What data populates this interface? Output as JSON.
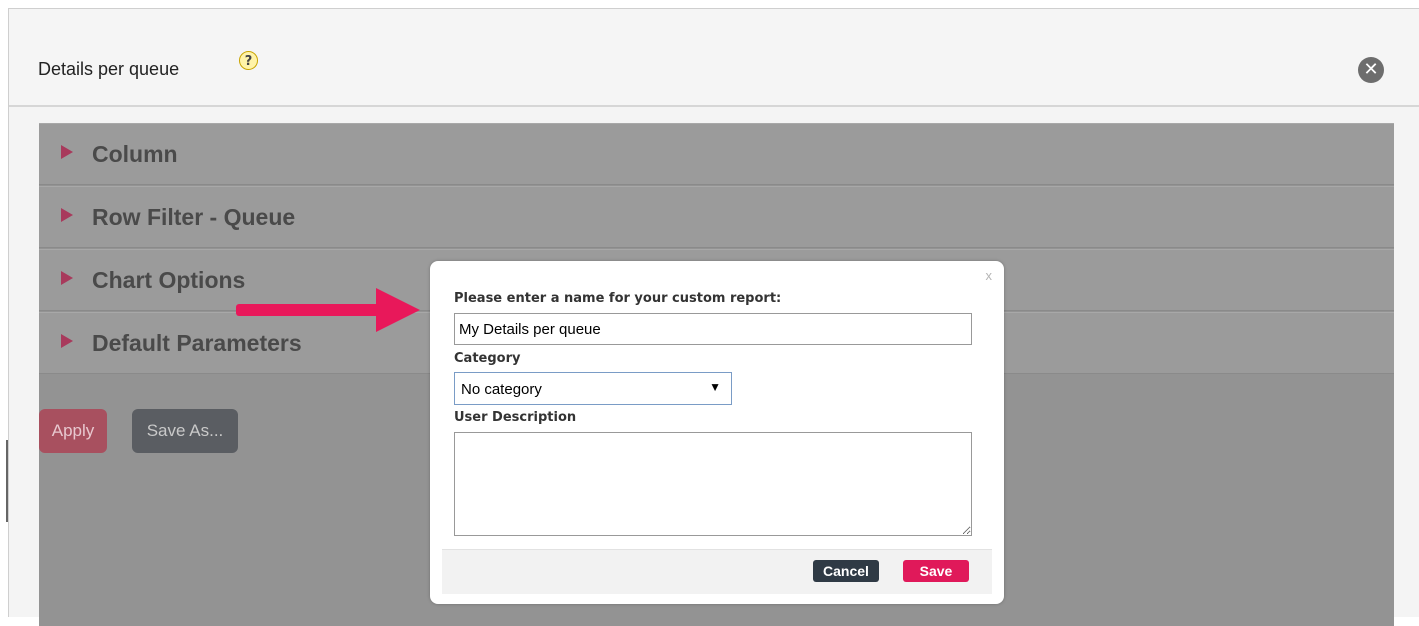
{
  "panel": {
    "title": "Details per queue",
    "help_icon": "?",
    "close_icon": "✕"
  },
  "sections": [
    {
      "label": "Column"
    },
    {
      "label": "Row Filter - Queue"
    },
    {
      "label": "Chart Options"
    },
    {
      "label": "Default Parameters"
    }
  ],
  "actions": {
    "apply_label": "Apply",
    "save_as_label": "Save As..."
  },
  "dialog": {
    "close_label": "x",
    "name_prompt": "Please enter a name for your custom report:",
    "name_value": "My Details per queue",
    "category_label": "Category",
    "category_value": "No category",
    "description_label": "User Description",
    "description_value": "",
    "cancel_label": "Cancel",
    "save_label": "Save"
  },
  "colors": {
    "accent": "#e0195a",
    "arrow": "#e8185a",
    "cancel": "#2f3a45"
  }
}
